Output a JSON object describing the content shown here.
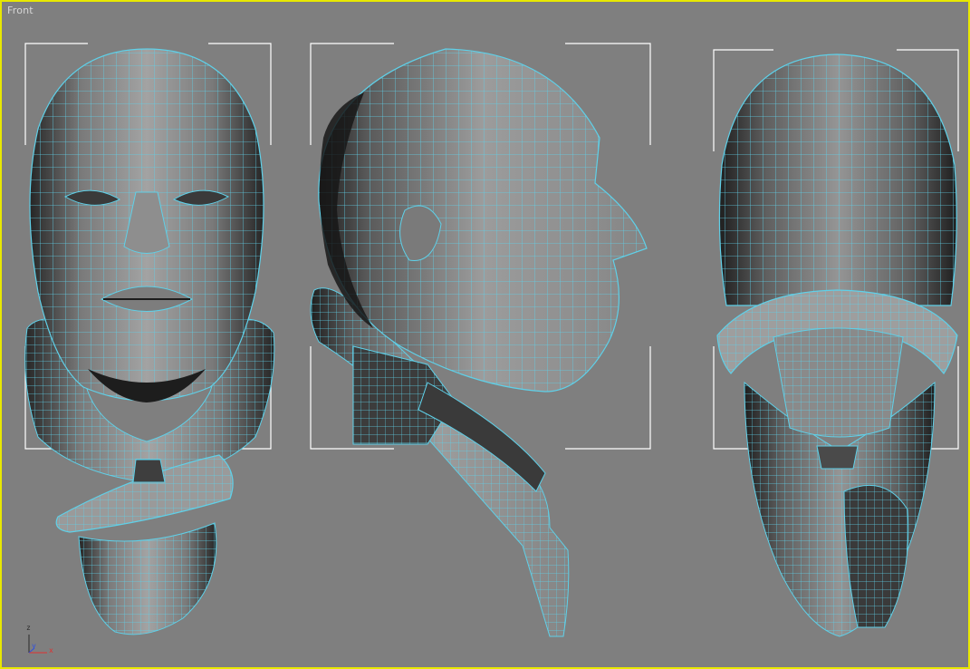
{
  "viewport": {
    "label": "Front",
    "border_color": "#e8e800",
    "background_color": "#7f7f7f"
  },
  "wireframe": {
    "edge_color": "#5fd0e8",
    "dark_shade": "#2b2b2b",
    "mid_shade": "#8d8d8d",
    "light_shade": "#a6a6a6"
  },
  "models": [
    {
      "name": "head-front-view"
    },
    {
      "name": "head-side-view"
    },
    {
      "name": "head-back-view"
    }
  ],
  "axis_gizmo": {
    "z_label": "z",
    "y_label": "y",
    "x_label": "x",
    "x_color": "#e03030",
    "y_color": "#3050e0",
    "z_color": "#2a2a2a"
  }
}
